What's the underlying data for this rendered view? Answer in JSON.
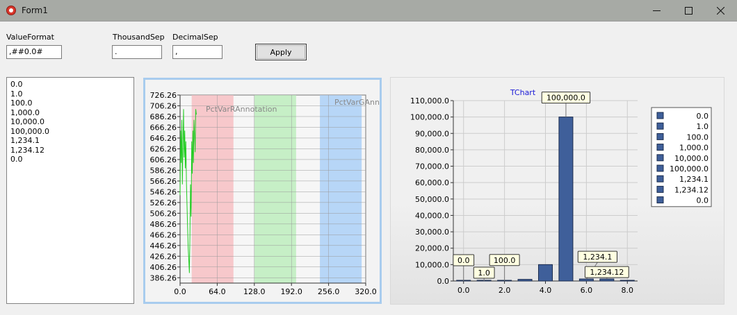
{
  "window": {
    "title": "Form1"
  },
  "form": {
    "value_format_label": "ValueFormat",
    "value_format_value": ",##0.0#",
    "thousand_sep_label": "ThousandSep",
    "thousand_sep_value": ".",
    "decimal_sep_label": "DecimalSep",
    "decimal_sep_value": ",",
    "apply_label": "Apply"
  },
  "list": {
    "items": [
      "0.0",
      "1.0",
      "100.0",
      "1,000.0",
      "10,000.0",
      "100,000.0",
      "1,234.1",
      "1,234.12",
      "0.0"
    ]
  },
  "chart_data": [
    {
      "type": "line",
      "title": "",
      "xlabel": "",
      "ylabel": "",
      "xlim": [
        0,
        320
      ],
      "ylim": [
        376.26,
        726.26
      ],
      "x_ticks": [
        "0.0",
        "64.0",
        "128.0",
        "192.0",
        "256.0",
        "320.0"
      ],
      "y_ticks": [
        "386.26",
        "406.26",
        "426.26",
        "446.26",
        "466.26",
        "486.26",
        "506.26",
        "526.26",
        "546.26",
        "566.26",
        "586.26",
        "606.26",
        "626.26",
        "646.26",
        "666.26",
        "686.26",
        "706.26",
        "726.26"
      ],
      "line_color": "#22cc22",
      "series": [
        {
          "x": [
            0,
            1,
            2,
            3,
            4,
            5,
            6,
            7,
            8,
            9,
            10,
            11,
            12,
            13,
            14,
            15,
            16,
            17,
            18,
            19,
            20,
            21,
            22,
            23,
            24,
            25,
            26,
            27,
            28
          ],
          "values": [
            540,
            660,
            600,
            680,
            560,
            640,
            700,
            610,
            660,
            590,
            640,
            560,
            520,
            480,
            440,
            420,
            395,
            470,
            560,
            500,
            640,
            580,
            660,
            600,
            680,
            650,
            620,
            700,
            690
          ]
        }
      ],
      "bands": [
        {
          "from": 20,
          "to": 92,
          "color": "#f7c8cb"
        },
        {
          "from": 128,
          "to": 200,
          "color": "#c6efc6"
        },
        {
          "from": 241,
          "to": 313,
          "color": "#b7d6f7"
        }
      ],
      "annotations": [
        "PctVarRAnnotation",
        "PctVarGAnnot"
      ]
    },
    {
      "type": "bar",
      "title": "TChart",
      "xlabel": "",
      "ylabel": "",
      "xlim": [
        -0.5,
        8.5
      ],
      "ylim": [
        0,
        110000
      ],
      "x_ticks": [
        "0.0",
        "2.0",
        "4.0",
        "6.0",
        "8.0"
      ],
      "y_ticks": [
        "0.0",
        "10,000.0",
        "20,000.0",
        "30,000.0",
        "40,000.0",
        "50,000.0",
        "60,000.0",
        "70,000.0",
        "80,000.0",
        "90,000.0",
        "100,000.0",
        "110,000.0"
      ],
      "bar_color": "#3f5f9a",
      "categories": [
        0,
        1,
        2,
        3,
        4,
        5,
        6,
        7,
        8
      ],
      "values": [
        0,
        1,
        100,
        1000,
        10000,
        100000,
        1234.1,
        1234.12,
        0
      ],
      "point_labels": [
        "0.0",
        "1.0",
        "100.0",
        "",
        "",
        "100,000.0",
        "1,234.1",
        "1,234.12",
        ""
      ],
      "legend": {
        "placement": "right",
        "items": [
          "0.0",
          "1.0",
          "100.0",
          "1,000.0",
          "10,000.0",
          "100,000.0",
          "1,234.1",
          "1,234.12",
          "0.0"
        ]
      }
    }
  ],
  "icons": {
    "app": "app-icon",
    "minimize": "minimize-icon",
    "maximize": "maximize-icon",
    "close": "close-icon"
  }
}
